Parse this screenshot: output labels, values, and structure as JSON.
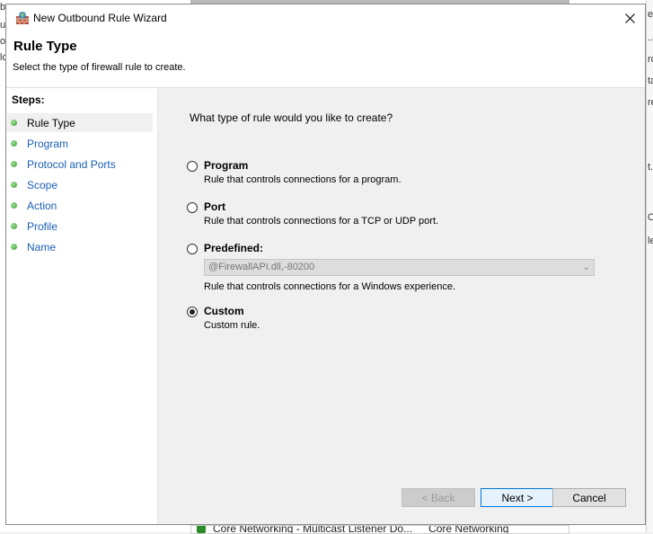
{
  "window": {
    "title": "New Outbound Rule Wizard"
  },
  "header": {
    "title": "Rule Type",
    "description": "Select the type of firewall rule to create."
  },
  "steps": {
    "label": "Steps:",
    "items": [
      {
        "label": "Rule Type",
        "active": true
      },
      {
        "label": "Program"
      },
      {
        "label": "Protocol and Ports"
      },
      {
        "label": "Scope"
      },
      {
        "label": "Action"
      },
      {
        "label": "Profile"
      },
      {
        "label": "Name"
      }
    ]
  },
  "main": {
    "question": "What type of rule would you like to create?",
    "options": [
      {
        "label": "Program",
        "description": "Rule that controls connections for a program.",
        "checked": false
      },
      {
        "label": "Port",
        "description": "Rule that controls connections for a TCP or UDP port.",
        "checked": false
      },
      {
        "label": "Predefined:",
        "description": "Rule that controls connections for a Windows experience.",
        "checked": false
      },
      {
        "label": "Custom",
        "description": "Custom rule.",
        "checked": true
      }
    ],
    "predefined_select": {
      "value": "@FirewallAPI.dll,-80200"
    }
  },
  "buttons": {
    "back": "< Back",
    "next": "Next >",
    "cancel": "Cancel"
  },
  "background": {
    "bottom_row": {
      "name": "Core Networking - Multicast Listener Do...",
      "group": "Core Networking"
    },
    "left_fragments": [
      "b",
      "u",
      "o",
      "lo"
    ],
    "right_fragments": [
      "es",
      "...",
      "ro",
      "ta",
      "re",
      "t.",
      "O",
      "le"
    ]
  },
  "colors": {
    "link": "#1a5fb4",
    "step_dot": "#3a9b31",
    "accent": "#0078d7"
  }
}
